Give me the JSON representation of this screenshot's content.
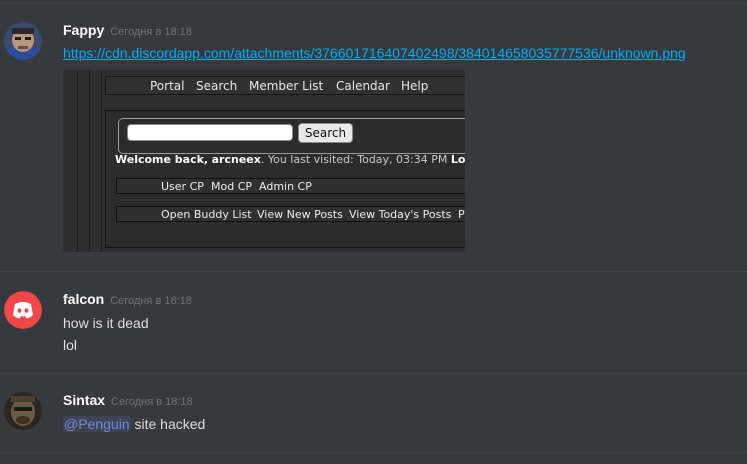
{
  "messages": [
    {
      "username": "Fappy",
      "timestamp": "Сегодня в 18:18",
      "link": "https://cdn.discordapp.com/attachments/376601716407402498/384014658035777536/unknown.png",
      "attachment": {
        "nav": [
          "Portal",
          "Search",
          "Member List",
          "Calendar",
          "Help"
        ],
        "search_button": "Search",
        "welcome_prefix": "Welcome back,",
        "welcome_user": "arcneex",
        "welcome_suffix": ". You last visited: Today, 03:34 PM",
        "welcome_tail": "Log",
        "cp_links": [
          "User CP",
          "Mod CP",
          "Admin CP"
        ],
        "quick_links": [
          "Open Buddy List",
          "View New Posts",
          "View Today's Posts",
          "P"
        ]
      }
    },
    {
      "username": "falcon",
      "timestamp": "Сегодня в 18:18",
      "lines": [
        "how is it dead",
        "lol"
      ]
    },
    {
      "username": "Sintax",
      "timestamp": "Сегодня в 18:18",
      "mention": "@Penguin",
      "text": " site hacked"
    }
  ],
  "colors": {
    "background": "#36393e",
    "link": "#00b0f4",
    "mention": "#7289da",
    "discord_blurple_red": "#f04747"
  }
}
